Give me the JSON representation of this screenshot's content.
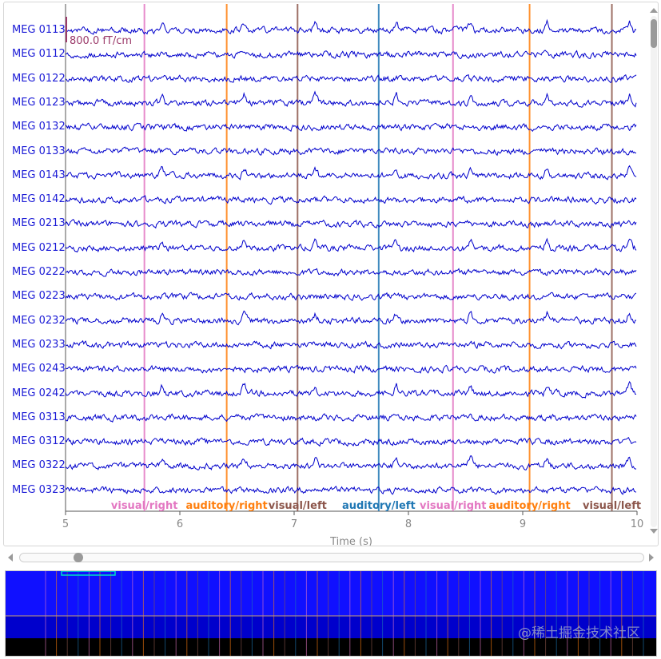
{
  "scale_bar": {
    "label": "800.0 fT/cm",
    "color": "#9b3a6a"
  },
  "channels": [
    "MEG 0113",
    "MEG 0112",
    "MEG 0122",
    "MEG 0123",
    "MEG 0132",
    "MEG 0133",
    "MEG 0143",
    "MEG 0142",
    "MEG 0213",
    "MEG 0212",
    "MEG 0222",
    "MEG 0223",
    "MEG 0232",
    "MEG 0233",
    "MEG 0243",
    "MEG 0242",
    "MEG 0313",
    "MEG 0312",
    "MEG 0322",
    "MEG 0323"
  ],
  "x_axis": {
    "label": "Time (s)",
    "ticks": [
      "5",
      "6",
      "7",
      "8",
      "9",
      "10"
    ],
    "range": [
      5,
      10
    ]
  },
  "events": [
    {
      "time": 5.69,
      "label": "visual/right",
      "color": "#e377c2"
    },
    {
      "time": 6.41,
      "label": "auditory/right",
      "color": "#ff7f0e"
    },
    {
      "time": 7.03,
      "label": "visual/left",
      "color": "#8c564b"
    },
    {
      "time": 7.74,
      "label": "auditory/left",
      "color": "#1f77b4"
    },
    {
      "time": 8.39,
      "label": "visual/right",
      "color": "#e377c2"
    },
    {
      "time": 9.06,
      "label": "auditory/right",
      "color": "#ff7f0e"
    },
    {
      "time": 9.78,
      "label": "visual/left",
      "color": "#8c564b"
    }
  ],
  "trace_color": "#0000cc",
  "overview_color": "#1010ff",
  "watermark": "@稀土掘金技术社区",
  "icons": {
    "scroll_up": "scroll-up-icon",
    "scroll_down": "scroll-down-icon",
    "scroll_left": "scroll-left-icon",
    "scroll_right": "scroll-right-icon"
  }
}
